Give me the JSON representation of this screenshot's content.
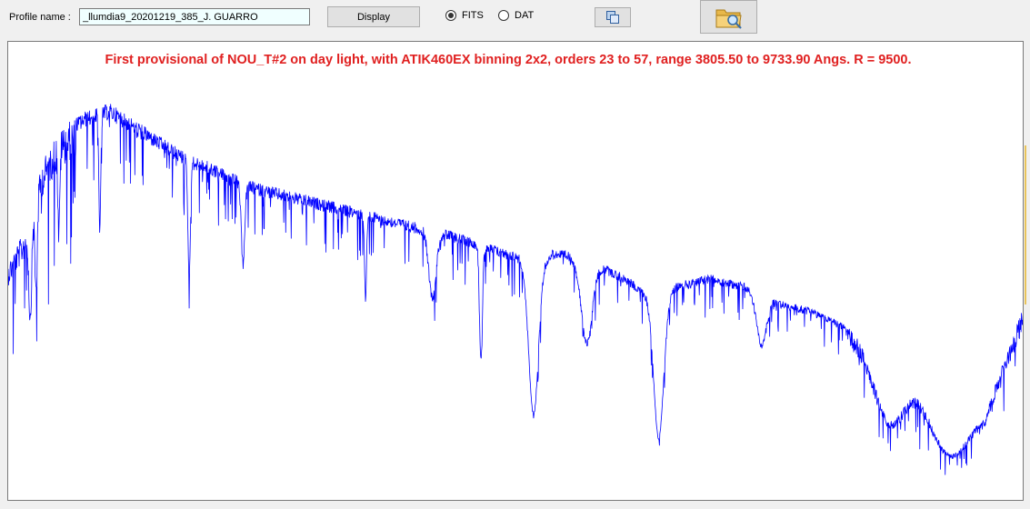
{
  "toolbar": {
    "profile_label": "Profile name :",
    "profile_value": "_llumdia9_20201219_385_J. GUARRO",
    "display_label": "Display",
    "fits_label": "FITS",
    "dat_label": "DAT",
    "selected_format": "FITS",
    "copy_icon": "copy-icon",
    "folder_icon": "folder-search-icon"
  },
  "plot": {
    "title": "First provisional of NOU_T#2 on day light, with ATIK460EX binning 2x2,  orders 23 to 57, range 3805.50 to 9733.90 Angs. R = 9500.",
    "title_color": "#e02020",
    "line_color": "#0000ff"
  },
  "chart_data": {
    "type": "line",
    "title": "First provisional of NOU_T#2 on day light, with ATIK460EX binning 2x2,  orders 23 to 57, range 3805.50 to 9733.90 Angs. R = 9500.",
    "xlabel": "",
    "ylabel": "",
    "xlim": [
      3805.5,
      9733.9
    ],
    "grid": false,
    "series": [
      {
        "values_profile": "solar spectrum envelope (approximate)",
        "x": [
          3805.5,
          3900,
          4000,
          4100,
          4250,
          4400,
          4550,
          4700,
          4860,
          5000,
          5200,
          5400,
          5600,
          5800,
          6000,
          6200,
          6400,
          6563,
          6700,
          6870,
          7000,
          7200,
          7400,
          7600,
          7700,
          7900,
          8100,
          8300,
          8500,
          8700,
          8900,
          9100,
          9300,
          9500,
          9733.9
        ],
        "values": [
          0.55,
          0.62,
          0.78,
          0.86,
          0.9,
          0.92,
          0.88,
          0.84,
          0.8,
          0.78,
          0.74,
          0.72,
          0.7,
          0.68,
          0.66,
          0.64,
          0.62,
          0.6,
          0.58,
          0.56,
          0.58,
          0.56,
          0.52,
          0.46,
          0.5,
          0.52,
          0.5,
          0.46,
          0.44,
          0.4,
          0.34,
          0.28,
          0.22,
          0.2,
          0.45
        ]
      }
    ]
  }
}
